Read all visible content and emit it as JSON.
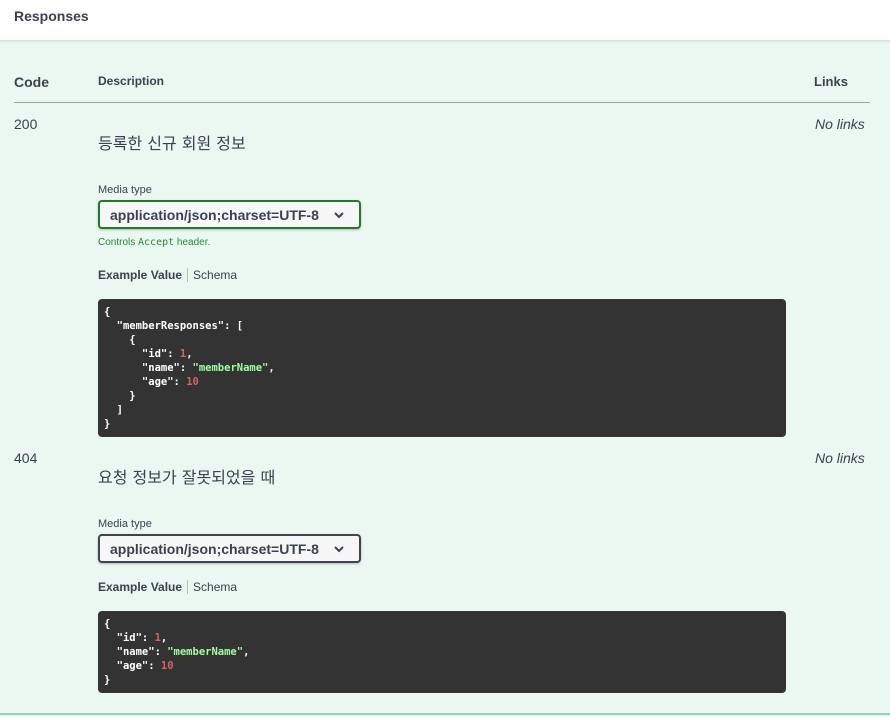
{
  "section": {
    "title": "Responses"
  },
  "table": {
    "col_code": "Code",
    "col_description": "Description",
    "col_links": "Links"
  },
  "responses": [
    {
      "code": "200",
      "description": "등록한 신규 회원 정보",
      "links": "No links",
      "media_label": "Media type",
      "media_value": "application/json;charset=UTF-8",
      "controls_prefix": "Controls ",
      "controls_code": "Accept",
      "controls_suffix": " header.",
      "tab_example": "Example Value",
      "tab_schema": "Schema",
      "example": "{\n  \"memberResponses\": [\n    {\n      \"id\": 1,\n      \"name\": \"memberName\",\n      \"age\": 10\n    }\n  ]\n}"
    },
    {
      "code": "404",
      "description": "요청 정보가 잘못되었을 때",
      "links": "No links",
      "media_label": "Media type",
      "media_value": "application/json;charset=UTF-8",
      "tab_example": "Example Value",
      "tab_schema": "Schema",
      "example": "{\n  \"id\": 1,\n  \"name\": \"memberName\",\n  \"age\": 10\n}"
    }
  ],
  "icons": {
    "dropdown": "chevron-down-icon"
  },
  "colors": {
    "background": "#ebf7f1",
    "active_border": "#237a2a",
    "code_bg": "#333333",
    "number": "#d36363",
    "string": "#a2fca2"
  }
}
